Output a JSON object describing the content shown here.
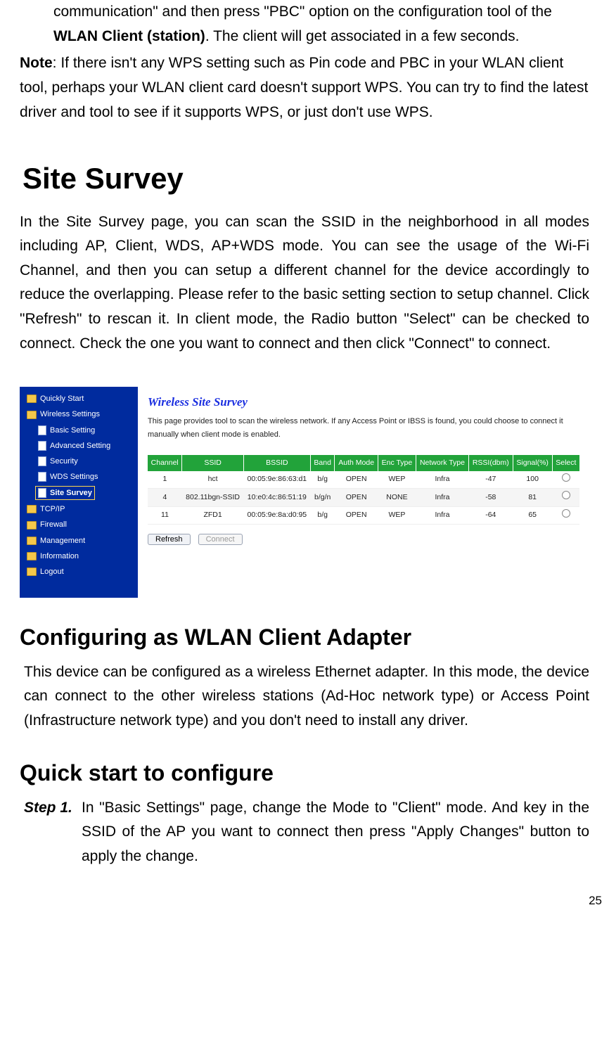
{
  "p1_a": "communication\" and then press \"PBC\" option on the configuration tool of the ",
  "p1_b": "WLAN Client (station)",
  "p1_c": ". The client will get associated in a few seconds.",
  "note_label": "Note",
  "note_text": ": If there isn't any WPS setting such as Pin code and PBC in your WLAN client tool, perhaps your WLAN client card doesn't support WPS. You can try to find the latest driver and tool to see if it supports WPS, or just don't use WPS.",
  "h_site": "Site Survey",
  "p_site": "In the Site Survey page, you can scan the SSID in the neighborhood in all modes including AP, Client, WDS, AP+WDS mode. You can see the usage of the Wi-Fi Channel, and then you can setup a different channel for the device accordingly to reduce the overlapping. Please refer to the basic setting section to setup channel. Click \"Refresh\" to rescan it. In client mode, the Radio button \"Select\" can be checked to connect. Check the one you want to connect and then click \"Connect\" to connect.",
  "screenshot": {
    "sidebar": {
      "items": [
        {
          "label": "Quickly Start",
          "type": "folder",
          "sub": false
        },
        {
          "label": "Wireless Settings",
          "type": "folder",
          "sub": false
        },
        {
          "label": "Basic Setting",
          "type": "page",
          "sub": true
        },
        {
          "label": "Advanced Setting",
          "type": "page",
          "sub": true
        },
        {
          "label": "Security",
          "type": "page",
          "sub": true
        },
        {
          "label": "WDS Settings",
          "type": "page",
          "sub": true
        },
        {
          "label": "Site Survey",
          "type": "page",
          "sub": true,
          "selected": true
        },
        {
          "label": "TCP/IP",
          "type": "folder",
          "sub": false
        },
        {
          "label": "Firewall",
          "type": "folder",
          "sub": false
        },
        {
          "label": "Management",
          "type": "folder",
          "sub": false
        },
        {
          "label": "Information",
          "type": "folder",
          "sub": false
        },
        {
          "label": "Logout",
          "type": "folder",
          "sub": false
        }
      ]
    },
    "title": "Wireless Site Survey",
    "desc": "This page provides tool to scan the wireless network. If any Access Point or IBSS is found, you could choose to connect it manually when client mode is enabled.",
    "headers": [
      "Channel",
      "SSID",
      "BSSID",
      "Band",
      "Auth Mode",
      "Enc Type",
      "Network Type",
      "RSSI(dbm)",
      "Signal(%)",
      "Select"
    ],
    "rows": [
      {
        "ch": "1",
        "ssid": "hct",
        "bssid": "00:05:9e:86:63:d1",
        "band": "b/g",
        "auth": "OPEN",
        "enc": "WEP",
        "nt": "Infra",
        "rssi": "-47",
        "sig": "100"
      },
      {
        "ch": "4",
        "ssid": "802.11bgn-SSID",
        "bssid": "10:e0:4c:86:51:19",
        "band": "b/g/n",
        "auth": "OPEN",
        "enc": "NONE",
        "nt": "Infra",
        "rssi": "-58",
        "sig": "81"
      },
      {
        "ch": "11",
        "ssid": "ZFD1",
        "bssid": "00:05:9e:8a:d0:95",
        "band": "b/g",
        "auth": "OPEN",
        "enc": "WEP",
        "nt": "Infra",
        "rssi": "-64",
        "sig": "65"
      }
    ],
    "refresh": "Refresh",
    "connect": "Connect"
  },
  "h_cfg": "Configuring as WLAN Client Adapter",
  "p_cfg": "This device can be configured as a wireless Ethernet adapter. In this mode, the device can connect to the other wireless stations (Ad-Hoc network type) or Access Point (Infrastructure network type) and you don't need to install any driver.",
  "h_quick": "Quick start to configure",
  "step1_label": "Step 1.",
  "step1_text": "In \"Basic Settings\" page, change the Mode to \"Client\" mode. And key in the SSID of the AP you want to connect then press \"Apply Changes\" button to apply the change.",
  "page_num": "25"
}
